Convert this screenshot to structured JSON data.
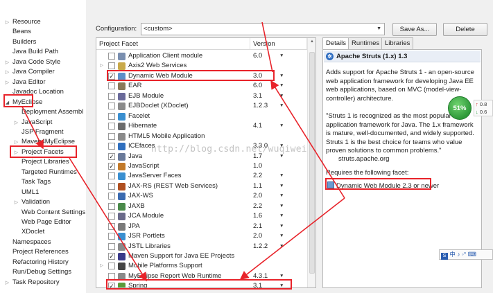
{
  "nav": {
    "items": [
      {
        "label": "Resource",
        "twisty": "closed",
        "indent": 0
      },
      {
        "label": "Beans",
        "twisty": "none",
        "indent": 0
      },
      {
        "label": "Builders",
        "twisty": "none",
        "indent": 0
      },
      {
        "label": "Java Build Path",
        "twisty": "none",
        "indent": 0
      },
      {
        "label": "Java Code Style",
        "twisty": "closed",
        "indent": 0
      },
      {
        "label": "Java Compiler",
        "twisty": "closed",
        "indent": 0
      },
      {
        "label": "Java Editor",
        "twisty": "closed",
        "indent": 0
      },
      {
        "label": "Javadoc Location",
        "twisty": "none",
        "indent": 0
      },
      {
        "label": "MyEclipse",
        "twisty": "open",
        "indent": 0
      },
      {
        "label": "Deployment Assembl",
        "twisty": "none",
        "indent": 1
      },
      {
        "label": "JavaScript",
        "twisty": "closed",
        "indent": 1
      },
      {
        "label": "JSP Fragment",
        "twisty": "none",
        "indent": 1
      },
      {
        "label": "Maven4MyEclipse",
        "twisty": "closed",
        "indent": 1
      },
      {
        "label": "Project Facets",
        "twisty": "closed",
        "indent": 1
      },
      {
        "label": "Project Libraries",
        "twisty": "none",
        "indent": 1
      },
      {
        "label": "Targeted Runtimes",
        "twisty": "none",
        "indent": 1
      },
      {
        "label": "Task Tags",
        "twisty": "none",
        "indent": 1
      },
      {
        "label": "UML1",
        "twisty": "none",
        "indent": 1
      },
      {
        "label": "Validation",
        "twisty": "closed",
        "indent": 1
      },
      {
        "label": "Web Content Settings",
        "twisty": "none",
        "indent": 1
      },
      {
        "label": "Web Page Editor",
        "twisty": "none",
        "indent": 1
      },
      {
        "label": "XDoclet",
        "twisty": "none",
        "indent": 1
      },
      {
        "label": "Namespaces",
        "twisty": "none",
        "indent": 0
      },
      {
        "label": "Project References",
        "twisty": "none",
        "indent": 0
      },
      {
        "label": "Refactoring History",
        "twisty": "none",
        "indent": 0
      },
      {
        "label": "Run/Debug Settings",
        "twisty": "none",
        "indent": 0
      },
      {
        "label": "Task Repository",
        "twisty": "closed",
        "indent": 0
      }
    ]
  },
  "config": {
    "label": "Configuration:",
    "value": "<custom>",
    "save_as": "Save As...",
    "delete": "Delete"
  },
  "table": {
    "col_facet": "Project Facet",
    "col_version": "Version",
    "rows": [
      {
        "name": "Application Client module",
        "version": "6.0",
        "checked": false,
        "expand": false,
        "dropdown": true,
        "icon": "ear-icon",
        "color": "#7a8fb0"
      },
      {
        "name": "Axis2 Web Services",
        "version": "",
        "checked": false,
        "expand": true,
        "dropdown": false,
        "icon": "folder-icon",
        "color": "#c9a94a"
      },
      {
        "name": "Dynamic Web Module",
        "version": "3.0",
        "checked": true,
        "expand": false,
        "dropdown": true,
        "icon": "web-module-icon",
        "color": "#5d8fc9"
      },
      {
        "name": "EAR",
        "version": "6.0",
        "checked": false,
        "expand": false,
        "dropdown": true,
        "icon": "ear-icon",
        "color": "#8a7a5a"
      },
      {
        "name": "EJB Module",
        "version": "3.1",
        "checked": false,
        "expand": false,
        "dropdown": true,
        "icon": "ejb-icon",
        "color": "#6a6a9a"
      },
      {
        "name": "EJBDoclet (XDoclet)",
        "version": "1.2.3",
        "checked": false,
        "expand": false,
        "dropdown": true,
        "icon": "doclet-icon",
        "color": "#8a8a8a"
      },
      {
        "name": "Facelet",
        "version": "",
        "checked": false,
        "expand": false,
        "dropdown": false,
        "icon": "facelet-icon",
        "color": "#3a8fd0"
      },
      {
        "name": "Hibernate",
        "version": "4.1",
        "checked": false,
        "expand": false,
        "dropdown": true,
        "icon": "hibernate-icon",
        "color": "#6b6b6b"
      },
      {
        "name": "HTML5 Mobile Application",
        "version": "",
        "checked": false,
        "expand": false,
        "dropdown": false,
        "icon": "html5-icon",
        "color": "#8a8a8a"
      },
      {
        "name": "ICEfaces",
        "version": "3.3.0",
        "checked": false,
        "expand": false,
        "dropdown": true,
        "icon": "icefaces-icon",
        "color": "#2f6fbf"
      },
      {
        "name": "Java",
        "version": "1.7",
        "checked": true,
        "expand": false,
        "dropdown": true,
        "icon": "java-icon",
        "color": "#6a7a9a"
      },
      {
        "name": "JavaScript",
        "version": "1.0",
        "checked": true,
        "expand": false,
        "dropdown": false,
        "icon": "javascript-icon",
        "color": "#c27a2a"
      },
      {
        "name": "JavaServer Faces",
        "version": "2.2",
        "checked": false,
        "expand": false,
        "dropdown": true,
        "icon": "jsf-icon",
        "color": "#3a8fd0"
      },
      {
        "name": "JAX-RS (REST Web Services)",
        "version": "1.1",
        "checked": false,
        "expand": false,
        "dropdown": true,
        "icon": "jaxrs-icon",
        "color": "#b05020"
      },
      {
        "name": "JAX-WS",
        "version": "2.0",
        "checked": false,
        "expand": false,
        "dropdown": true,
        "icon": "jaxws-icon",
        "color": "#3a6ab0"
      },
      {
        "name": "JAXB",
        "version": "2.2",
        "checked": false,
        "expand": false,
        "dropdown": true,
        "icon": "jaxb-icon",
        "color": "#4a8a4a"
      },
      {
        "name": "JCA Module",
        "version": "1.6",
        "checked": false,
        "expand": false,
        "dropdown": true,
        "icon": "jca-icon",
        "color": "#6a6a8a"
      },
      {
        "name": "JPA",
        "version": "2.1",
        "checked": false,
        "expand": false,
        "dropdown": true,
        "icon": "jpa-icon",
        "color": "#7a7a7a"
      },
      {
        "name": "JSR Portlets",
        "version": "2.0",
        "checked": false,
        "expand": false,
        "dropdown": true,
        "icon": "portlet-icon",
        "color": "#3a8fd0"
      },
      {
        "name": "JSTL Libraries",
        "version": "1.2.2",
        "checked": false,
        "expand": false,
        "dropdown": true,
        "icon": "jstl-icon",
        "color": "#8a8a8a"
      },
      {
        "name": "Maven Support for Java EE Projects",
        "version": "",
        "checked": true,
        "expand": false,
        "dropdown": false,
        "icon": "maven-icon",
        "color": "#3a3a8a"
      },
      {
        "name": "Mobile Platforms Support",
        "version": "",
        "checked": false,
        "expand": true,
        "dropdown": false,
        "icon": "mobile-icon",
        "color": "#444444"
      },
      {
        "name": "MyEclipse Report Web Runtime",
        "version": "4.3.1",
        "checked": false,
        "expand": false,
        "dropdown": true,
        "icon": "report-icon",
        "color": "#8a8a8a"
      },
      {
        "name": "Spring",
        "version": "3.1",
        "checked": true,
        "expand": false,
        "dropdown": true,
        "icon": "spring-icon",
        "color": "#5a9a3a"
      }
    ]
  },
  "details": {
    "tabs": [
      "Details",
      "Runtimes",
      "Libraries"
    ],
    "title": "Apache Struts (1.x) 1.3",
    "desc1": "Adds support for Apache Struts 1 - an open-source web application framework for developing Java EE web applications, based on MVC (model-view-controller) architecture.",
    "desc2": "\"Struts 1 is recognized as the most popular application framework for Java. The 1.x framework is mature, well-documented, and widely supported. Struts 1 is the best choice for teams who value proven solutions to common problems.\"",
    "site": "struts.apache.org",
    "requires": "Requires the following facet:",
    "requires_item": "Dynamic Web Module 2.3 or newer"
  },
  "widgets": {
    "speed_percent": "51%",
    "speed_up": "0.8",
    "speed_down": "0.6",
    "ime_text": "中 ♪ ◦° ⌨"
  },
  "watermark": "http://blog.csdn.net/wuqiwei"
}
